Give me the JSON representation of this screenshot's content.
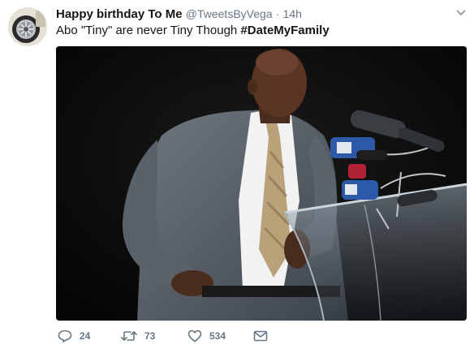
{
  "tweet": {
    "display_name": "Happy birthday To Me",
    "handle": "@TweetsByVega",
    "separator": "·",
    "time": "14h",
    "text_before": "Abo \"Tiny\" are never Tiny Though ",
    "hashtag": "#DateMyFamily",
    "avatar_icon": "car-wheel-icon",
    "media_description_icon": "photo-icon"
  },
  "actions": {
    "reply": {
      "icon": "reply-icon",
      "count": "24"
    },
    "retweet": {
      "icon": "retweet-icon",
      "count": "73"
    },
    "like": {
      "icon": "heart-icon",
      "count": "534"
    },
    "dm": {
      "icon": "envelope-icon"
    }
  },
  "colors": {
    "text": "#14171a",
    "secondary": "#657786",
    "background": "#ffffff"
  }
}
